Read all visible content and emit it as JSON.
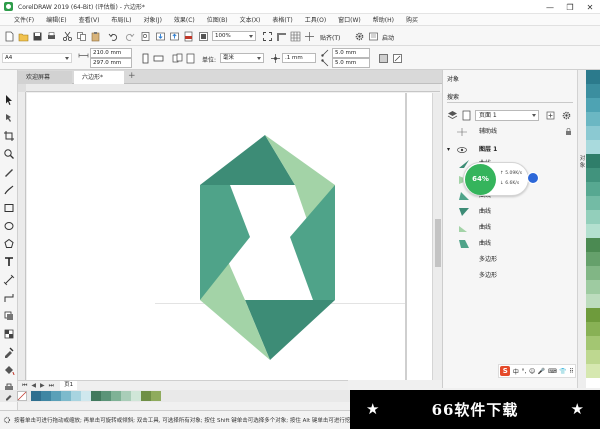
{
  "window": {
    "title": "CorelDRAW 2019 (64-Bit) (评估版) - 六边形*",
    "minimize_glyph": "—",
    "maximize_glyph": "❐",
    "close_glyph": "✕"
  },
  "menu": {
    "items": [
      "文件(F)",
      "编辑(E)",
      "查看(V)",
      "布局(L)",
      "对象(J)",
      "效果(C)",
      "位图(B)",
      "文本(X)",
      "表格(T)",
      "工具(O)",
      "窗口(W)",
      "帮助(H)",
      "购买"
    ]
  },
  "toolbar1": {
    "zoom_value": "100%",
    "snap_label": "贴齐(T)",
    "launch_label": "启动"
  },
  "toolbar2": {
    "paper_size": "A4",
    "width_value": "210.0 mm",
    "height_value": "297.0 mm",
    "units_label": "单位:",
    "units_value": "毫米",
    "nudge_value": ".1 mm",
    "dup_x_value": "5.0 mm",
    "dup_y_value": "5.0 mm"
  },
  "tabs": {
    "welcome": "欢迎屏幕",
    "document": "六边形*",
    "add_glyph": "+"
  },
  "page_nav": {
    "first_glyph": "⏮",
    "prev_glyph": "◀",
    "next_glyph": "▶",
    "last_glyph": "⏭",
    "page_tab": "页1"
  },
  "status": {
    "text": "按着单击可进行拖动或缩放; 再单击可旋转或倾斜; 双击工具, 可选择所有对象; 按住 Shift 键单击可选择多个对象; 按住 Alt 键单击可进行挖掘"
  },
  "objects_panel": {
    "title": "对象",
    "search_placeholder": "搜索",
    "page_name": "页面 1",
    "guides_layer": "辅助线",
    "layer_name": "图层 1",
    "items": [
      "曲线",
      "曲线",
      "曲线",
      "曲线",
      "曲线",
      "曲线",
      "多边形",
      "多边形"
    ],
    "side_tab": "对象"
  },
  "perf_widget": {
    "percent": "64%",
    "upload": "↑ 5.09K/s",
    "download": "↓ 6.6K/s"
  },
  "ime_bar": {
    "logo": "S",
    "lang": "中",
    "glyphs": [
      "°,",
      "☺",
      "🎤",
      "⌨",
      "👕",
      "⠿"
    ]
  },
  "watermark": {
    "star_left": "★",
    "text": "66软件下载",
    "star_right": "★"
  },
  "colors": {
    "hex_dark": "#3d8c76",
    "hex_mid": "#4fa389",
    "hex_light": "#a3d3a7",
    "palette": [
      "#2f6f8f",
      "#3f86a3",
      "#5aa0b8",
      "#7dbacc",
      "#a8d4e0",
      "#cfe8ee",
      "#417a5e",
      "#5b9478",
      "#7fb296",
      "#a9cdb8",
      "#d0e6d8",
      "#6f8f46",
      "#8fab5d"
    ],
    "strip": [
      "#2b7a8c",
      "#3b8e9f",
      "#4ea3b3",
      "#6bb7c3",
      "#8bc9d2",
      "#a9dadd",
      "#2f7e6a",
      "#41937d",
      "#57a891",
      "#73bba5",
      "#93cfbb",
      "#b3e0cf",
      "#4b8a52",
      "#65a06b",
      "#81b685",
      "#9ecba1",
      "#bcdcbd",
      "#6e9b3c",
      "#88b155",
      "#a3c672",
      "#bed890",
      "#d6e8b0"
    ]
  }
}
